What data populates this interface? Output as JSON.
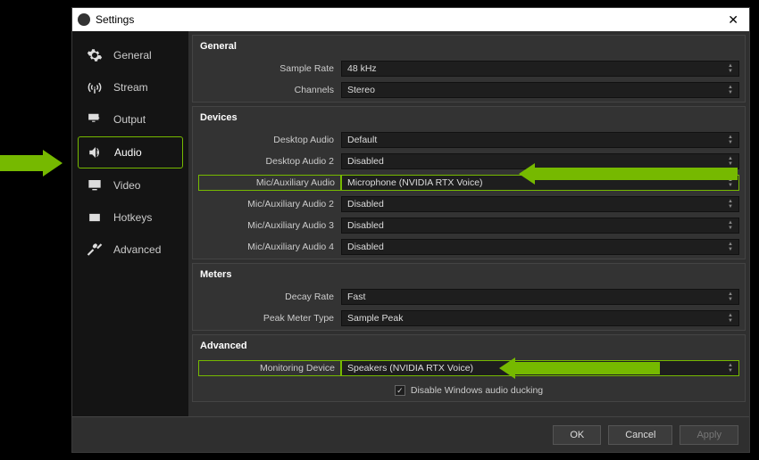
{
  "window": {
    "title": "Settings"
  },
  "sidebar": {
    "items": [
      {
        "label": "General"
      },
      {
        "label": "Stream"
      },
      {
        "label": "Output"
      },
      {
        "label": "Audio"
      },
      {
        "label": "Video"
      },
      {
        "label": "Hotkeys"
      },
      {
        "label": "Advanced"
      }
    ]
  },
  "sections": {
    "general": {
      "title": "General",
      "sample_rate": {
        "label": "Sample Rate",
        "value": "48 kHz"
      },
      "channels": {
        "label": "Channels",
        "value": "Stereo"
      }
    },
    "devices": {
      "title": "Devices",
      "desktop_audio": {
        "label": "Desktop Audio",
        "value": "Default"
      },
      "desktop_audio_2": {
        "label": "Desktop Audio 2",
        "value": "Disabled"
      },
      "mic_aux": {
        "label": "Mic/Auxiliary Audio",
        "value": "Microphone (NVIDIA RTX Voice)"
      },
      "mic_aux_2": {
        "label": "Mic/Auxiliary Audio 2",
        "value": "Disabled"
      },
      "mic_aux_3": {
        "label": "Mic/Auxiliary Audio 3",
        "value": "Disabled"
      },
      "mic_aux_4": {
        "label": "Mic/Auxiliary Audio 4",
        "value": "Disabled"
      }
    },
    "meters": {
      "title": "Meters",
      "decay_rate": {
        "label": "Decay Rate",
        "value": "Fast"
      },
      "peak_meter_type": {
        "label": "Peak Meter Type",
        "value": "Sample Peak"
      }
    },
    "advanced": {
      "title": "Advanced",
      "monitoring_device": {
        "label": "Monitoring Device",
        "value": "Speakers (NVIDIA RTX Voice)"
      },
      "disable_ducking": {
        "label": "Disable Windows audio ducking",
        "checked": true
      }
    }
  },
  "footer": {
    "ok": "OK",
    "cancel": "Cancel",
    "apply": "Apply"
  }
}
